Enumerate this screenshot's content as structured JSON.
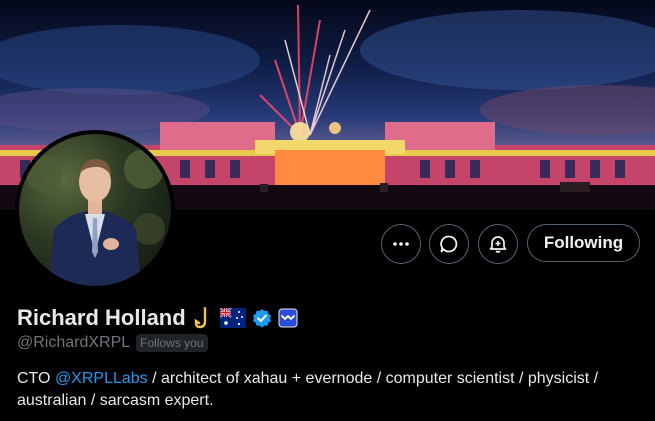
{
  "profile": {
    "name": "Richard Holland",
    "handle": "@RichardXRPL",
    "follows_you": "Follows you",
    "bio_prefix": "CTO ",
    "bio_mention": "@XRPLLabs",
    "bio_rest": " / architect of xahau + evernode / computer scientist / physicist / australian / sarcasm expert."
  },
  "actions": {
    "following_label": "Following"
  },
  "icons": {
    "more": "more-icon",
    "message": "message-icon",
    "subscribe": "notification-subscribe-icon",
    "hook": "hook-emoji-icon",
    "flag": "australia-flag-icon",
    "verified": "verified-badge-icon",
    "affiliate": "affiliate-badge-icon"
  },
  "colors": {
    "accent": "#1d9bf0",
    "muted": "#71767b",
    "border": "#536471"
  }
}
